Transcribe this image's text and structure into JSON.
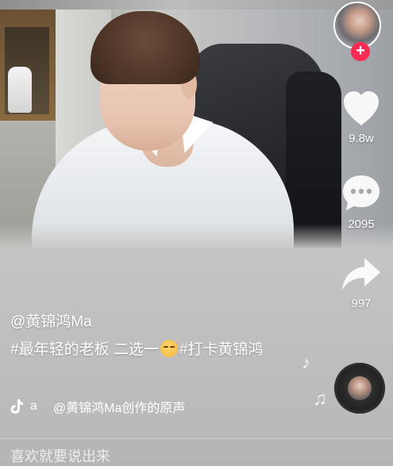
{
  "author": {
    "handle": "@黄锦鸿Ma"
  },
  "caption": {
    "part1": "#最年轻的老板",
    "part2": " 二选一",
    "emoji": "smirk-emoji",
    "part3": "#打卡黄锦鸿"
  },
  "music": {
    "prefix": "a",
    "title": "@黄锦鸿Ma创作的原声"
  },
  "actions": {
    "follow": "+",
    "likes": "9.8w",
    "comments": "2095",
    "shares": "997"
  },
  "comment_bar": {
    "placeholder": "喜欢就要说出来"
  },
  "icons": {
    "like": "heart-icon",
    "comment": "comment-bubble-icon",
    "share": "share-arrow-icon",
    "music": "tiktok-note-icon",
    "disc": "music-disc-icon"
  },
  "colors": {
    "follow": "#fe2c55",
    "text": "#ffffff"
  }
}
